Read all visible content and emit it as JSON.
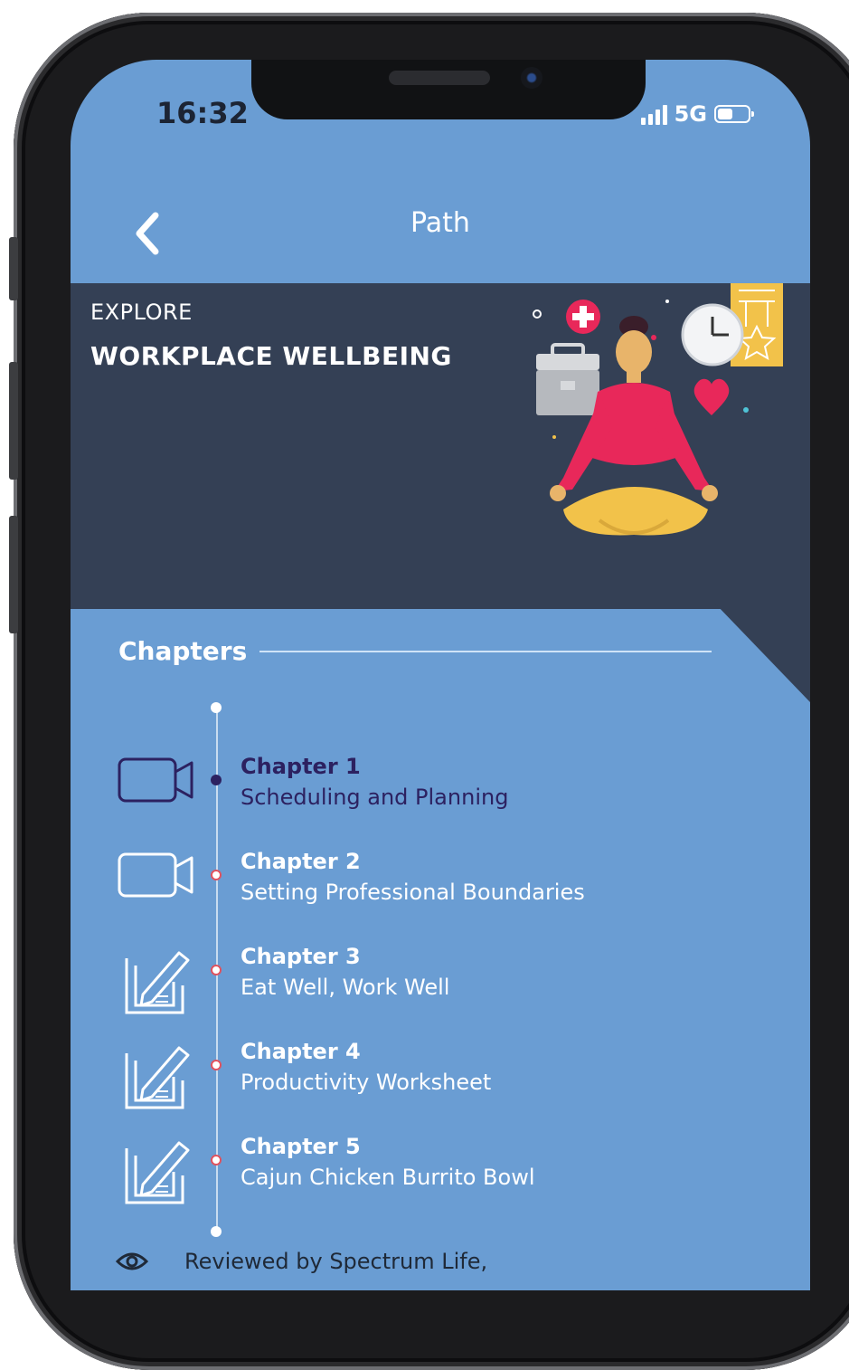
{
  "status_bar": {
    "time": "16:32",
    "network": "5G",
    "battery_level": 0.5
  },
  "navbar": {
    "title": "Path"
  },
  "hero": {
    "eyebrow": "EXPLORE",
    "title": "WORKPLACE WELLBEING"
  },
  "chapters": {
    "heading": "Chapters",
    "items": [
      {
        "title": "Chapter 1",
        "subtitle": "Scheduling and Planning",
        "icon": "video-icon",
        "state": "active"
      },
      {
        "title": "Chapter 2",
        "subtitle": "Setting Professional Boundaries",
        "icon": "video-icon",
        "state": "todo"
      },
      {
        "title": "Chapter 3",
        "subtitle": "Eat Well, Work Well",
        "icon": "article-icon",
        "state": "todo"
      },
      {
        "title": "Chapter 4",
        "subtitle": "Productivity Worksheet",
        "icon": "article-icon",
        "state": "todo"
      },
      {
        "title": "Chapter 5",
        "subtitle": "Cajun Chicken Burrito Bowl",
        "icon": "article-icon",
        "state": "todo"
      }
    ]
  },
  "footer": {
    "reviewed_text": "Reviewed by Spectrum Life,"
  },
  "colors": {
    "screen_bg": "#6a9dd3",
    "hero_bg": "#344055",
    "active_text": "#2c2160",
    "todo_dot": "#e2525d"
  }
}
